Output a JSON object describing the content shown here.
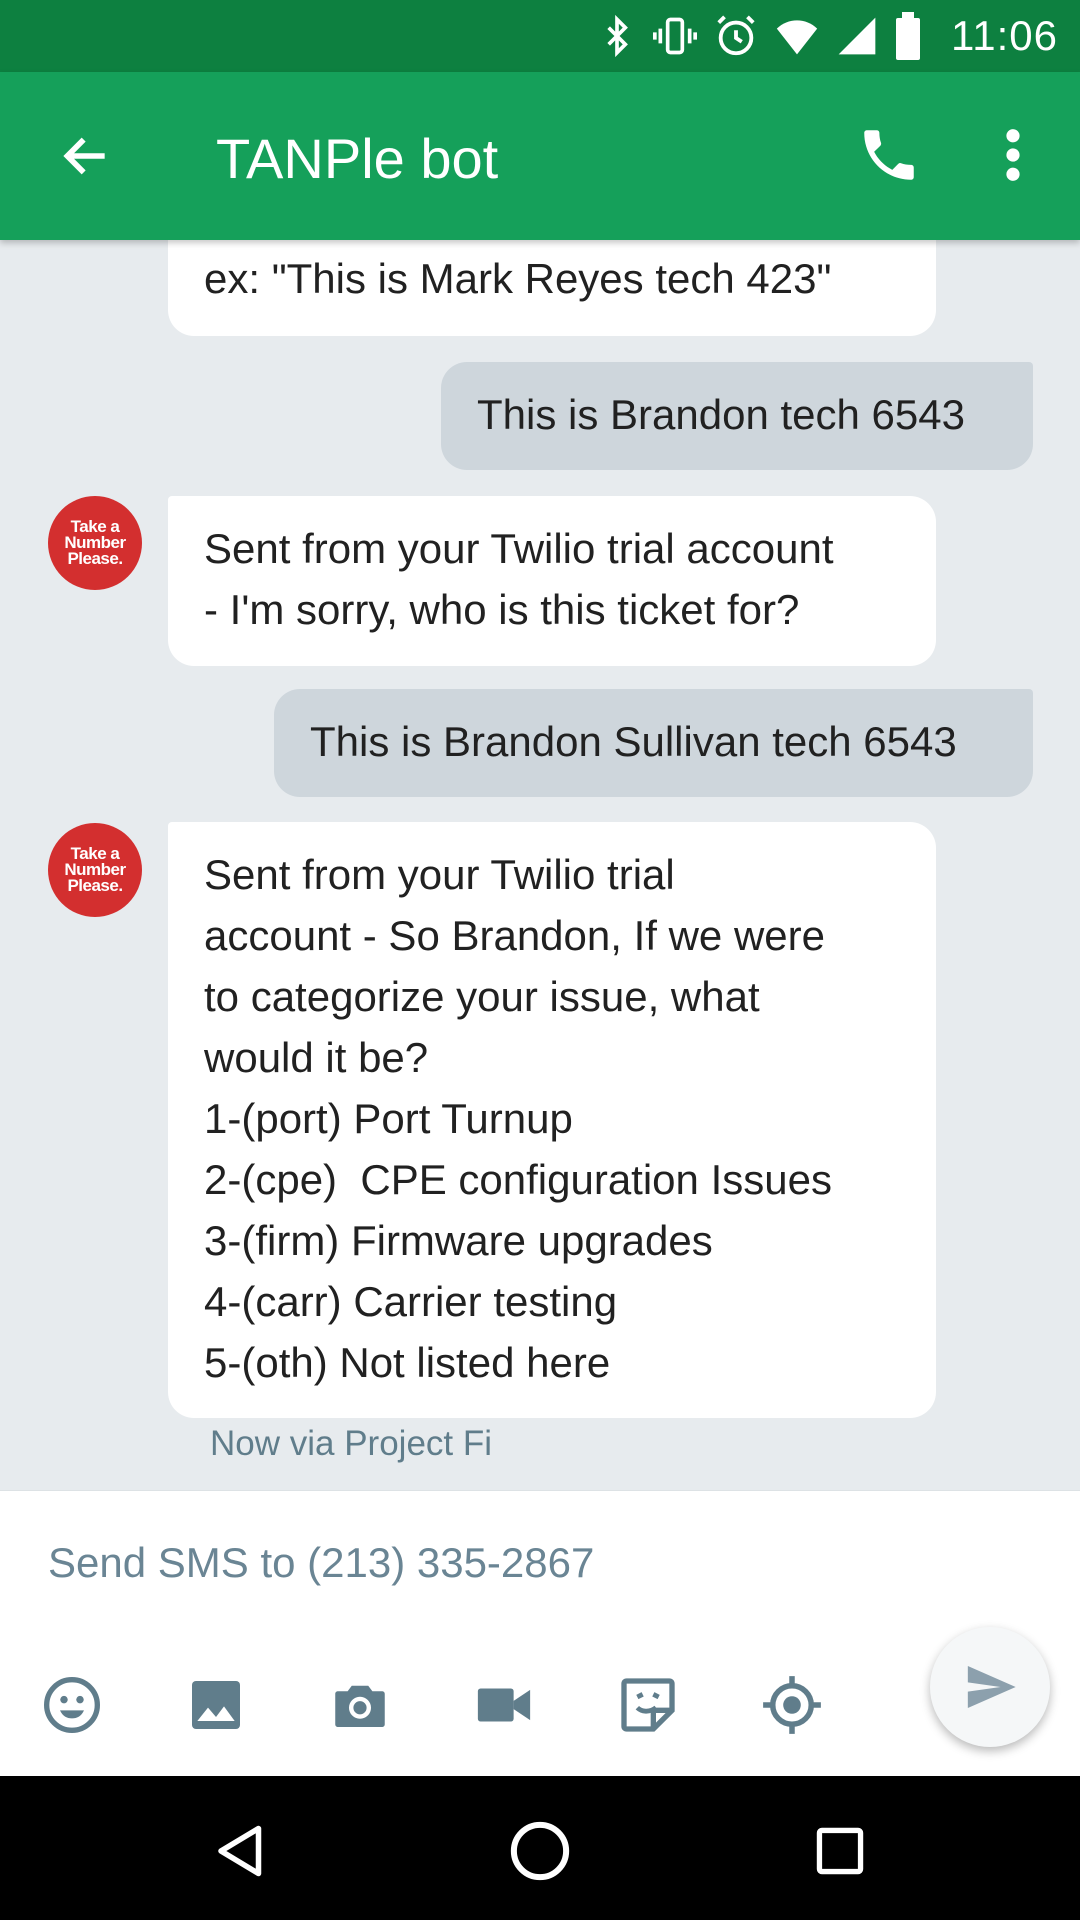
{
  "status_bar": {
    "time": "11:06",
    "icons": [
      "bluetooth-icon",
      "vibrate-icon",
      "alarm-icon",
      "wifi-icon",
      "signal-icon",
      "battery-icon"
    ]
  },
  "app_bar": {
    "title": "TANPle bot",
    "icons": [
      "back-arrow-icon",
      "phone-icon",
      "more-vert-icon"
    ],
    "color": "#15A05A",
    "status_color": "#0D8040"
  },
  "avatar": {
    "logo_lines": [
      "Take a",
      "Number",
      "Please."
    ],
    "color": "#D32F2F"
  },
  "messages": [
    {
      "direction": "in",
      "lines": [
        "ex: \"This is Mark Reyes tech 423\""
      ]
    },
    {
      "direction": "out",
      "lines": [
        "This is Brandon tech 6543"
      ]
    },
    {
      "direction": "in",
      "lines": [
        "Sent from your Twilio trial account",
        "- I'm sorry, who is this ticket for?"
      ]
    },
    {
      "direction": "out",
      "lines": [
        "This is Brandon Sullivan tech 6543"
      ]
    },
    {
      "direction": "in",
      "lines": [
        "Sent from your Twilio trial",
        "account - So Brandon, If we were",
        "to categorize your issue, what",
        "would it be?",
        "1-(port) Port Turnup",
        "2-(cpe)  CPE configuration Issues",
        "3-(firm) Firmware upgrades",
        "4-(carr) Carrier testing",
        "5-(oth) Not listed here"
      ]
    }
  ],
  "last_message_meta": "Now via Project Fi",
  "composer": {
    "placeholder": "Send SMS to (213) 335-2867",
    "tools": [
      "emoji-icon",
      "gallery-icon",
      "camera-icon",
      "video-icon",
      "sticker-icon",
      "location-icon"
    ],
    "send_icon": "send-icon"
  },
  "nav_bar": {
    "icons": [
      "nav-back-icon",
      "nav-home-icon",
      "nav-recents-icon"
    ]
  }
}
